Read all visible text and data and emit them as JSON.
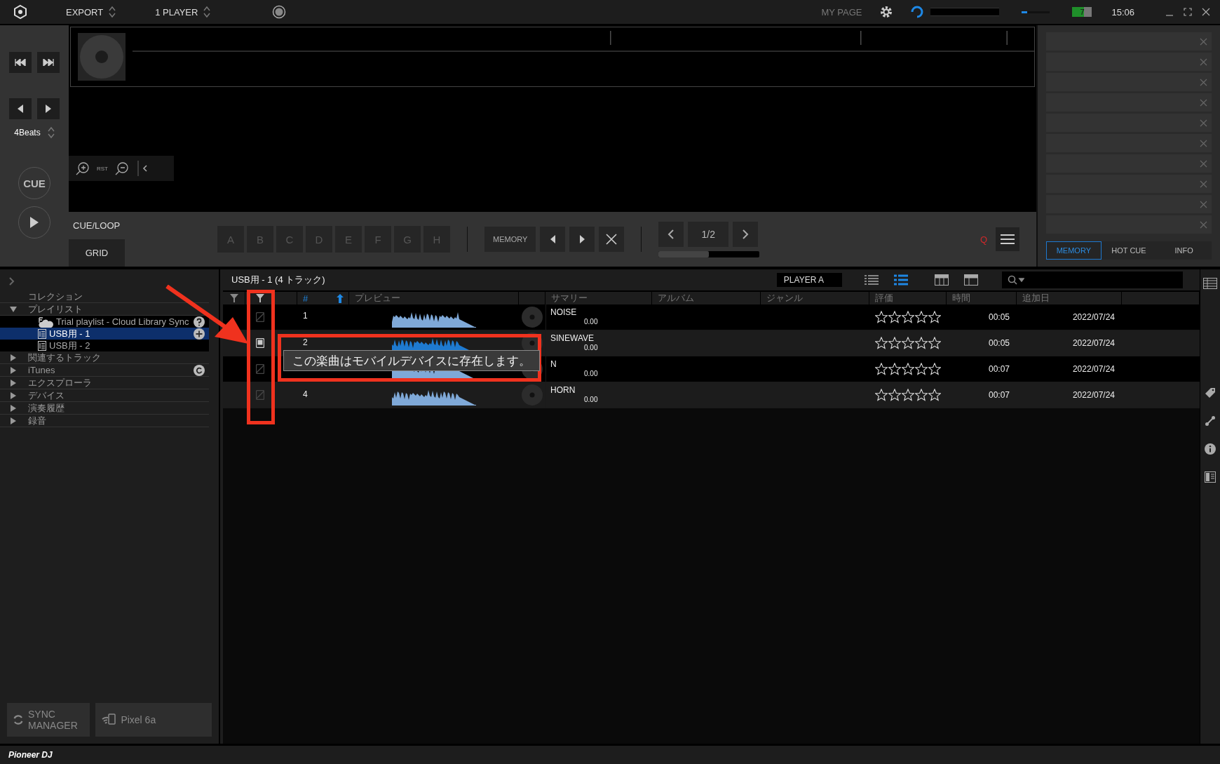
{
  "top_bar": {
    "mode": "EXPORT",
    "players": "1 PLAYER",
    "my_page": "MY PAGE",
    "volume": {
      "level": 0.2
    },
    "battery": "7",
    "clock": "15:06"
  },
  "deck": {
    "beat_jump": "4Beats",
    "zoom_reset": "RST",
    "cue": "CUE",
    "tabs": [
      {
        "label": "CUE/LOOP",
        "selected": false
      },
      {
        "label": "GRID",
        "selected": true
      }
    ],
    "hot_cues": [
      "A",
      "B",
      "C",
      "D",
      "E",
      "F",
      "G",
      "H"
    ],
    "memory": "MEMORY",
    "page": "1/2",
    "page_progress": {
      "level": 0.5
    },
    "quantize": "Q"
  },
  "memory_panel": {
    "tabs": [
      {
        "label": "MEMORY",
        "selected": true
      },
      {
        "label": "HOT CUE",
        "selected": false
      },
      {
        "label": "INFO",
        "selected": false
      }
    ]
  },
  "sidebar": {
    "items": [
      {
        "label": "コレクション",
        "kind": "plain"
      },
      {
        "label": "プレイリスト",
        "kind": "folder",
        "expanded": true,
        "children": [
          {
            "label": "Trial playlist - Cloud Library Sync",
            "kind": "cloud",
            "selected": false
          },
          {
            "label": "USB用 - 1",
            "kind": "list",
            "selected": true
          },
          {
            "label": "USB用 - 2",
            "kind": "list",
            "selected": false
          }
        ]
      },
      {
        "label": "関連するトラック",
        "kind": "folder",
        "expanded": false
      },
      {
        "label": "iTunes",
        "kind": "library",
        "expanded": false
      },
      {
        "label": "エクスプローラ",
        "kind": "folder",
        "expanded": false
      },
      {
        "label": "デバイス",
        "kind": "folder",
        "expanded": false
      },
      {
        "label": "演奏履歴",
        "kind": "folder",
        "expanded": false
      },
      {
        "label": "録音",
        "kind": "folder",
        "expanded": false
      }
    ],
    "sync_manager": "SYNC MANAGER",
    "device": "Pixel 6a"
  },
  "table": {
    "title": "USB用 - 1 (4 トラック)",
    "player": "PLAYER A",
    "columns": [
      "#",
      "プレビュー",
      "サマリー",
      "アルバム",
      "ジャンル",
      "評価",
      "時間",
      "追加日"
    ],
    "rows": [
      {
        "number": "1",
        "on_device": false,
        "title": "NOISE",
        "bpm": "0.00",
        "stars": 0,
        "time": "00:05",
        "added": "2022/07/24"
      },
      {
        "number": "2",
        "on_device": true,
        "title": "SINEWAVE",
        "bpm": "0.00",
        "stars": 0,
        "time": "00:05",
        "added": "2022/07/24"
      },
      {
        "on_device": false,
        "title": "N",
        "bpm": "0.00",
        "stars": 0,
        "time": "00:07",
        "added": "2022/07/24"
      },
      {
        "number": "4",
        "on_device": false,
        "title": "HORN",
        "bpm": "0.00",
        "stars": 0,
        "time": "00:07",
        "added": "2022/07/24"
      }
    ]
  },
  "tooltip": "この楽曲はモバイルデバイスに存在します。",
  "footer": {
    "brand": "Pioneer DJ"
  }
}
